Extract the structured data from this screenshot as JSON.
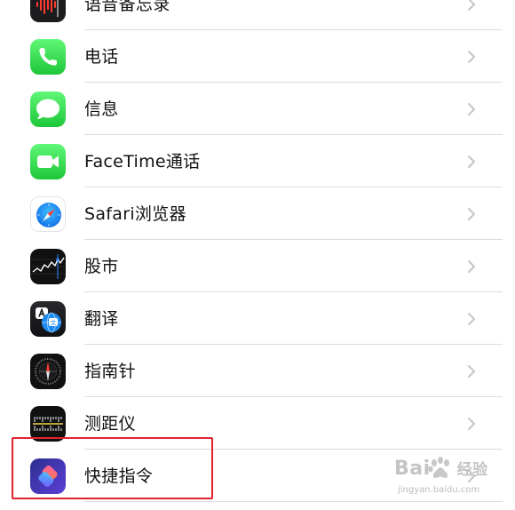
{
  "settings": {
    "items": [
      {
        "label": "语音备忘录",
        "icon": "voice-memos-icon"
      },
      {
        "label": "电话",
        "icon": "phone-icon"
      },
      {
        "label": "信息",
        "icon": "messages-icon"
      },
      {
        "label": "FaceTime通话",
        "icon": "facetime-icon"
      },
      {
        "label": "Safari浏览器",
        "icon": "safari-icon"
      },
      {
        "label": "股市",
        "icon": "stocks-icon"
      },
      {
        "label": "翻译",
        "icon": "translate-icon"
      },
      {
        "label": "指南针",
        "icon": "compass-icon"
      },
      {
        "label": "测距仪",
        "icon": "measure-icon"
      },
      {
        "label": "快捷指令",
        "icon": "shortcuts-icon"
      }
    ]
  },
  "colors": {
    "highlight": "#e0242b",
    "phone_green": "#34c759",
    "safari_blue": "#1a8cf0",
    "shortcuts_purple": "#5b3fd6"
  },
  "watermark": {
    "brand": "Bai",
    "brand_suffix": "经验",
    "url": "jingyan.baidu.com"
  }
}
